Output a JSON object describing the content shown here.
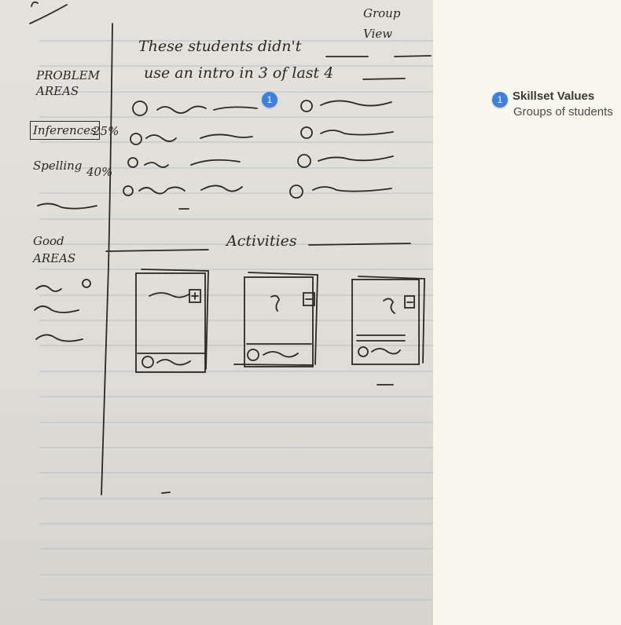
{
  "sketch": {
    "corner_note": "Group View",
    "heading_line1": "These students didn't",
    "heading_line2": "use an intro in 3 of last 4",
    "problem_areas": {
      "label": "PROBLEM AREAS",
      "items": [
        {
          "name": "Inferences",
          "percent": "25%"
        },
        {
          "name": "Spelling",
          "percent": "40%"
        }
      ]
    },
    "good_areas": {
      "label": "Good AREAS"
    },
    "activities_label": "Activities"
  },
  "annotation": {
    "marker": "1",
    "title": "Skillset Values",
    "subtitle": "Groups of students"
  },
  "colors": {
    "marker": "#3b82e0",
    "ink": "#2c2824",
    "paper": "#e0ded8",
    "background": "#f8f8ee"
  }
}
